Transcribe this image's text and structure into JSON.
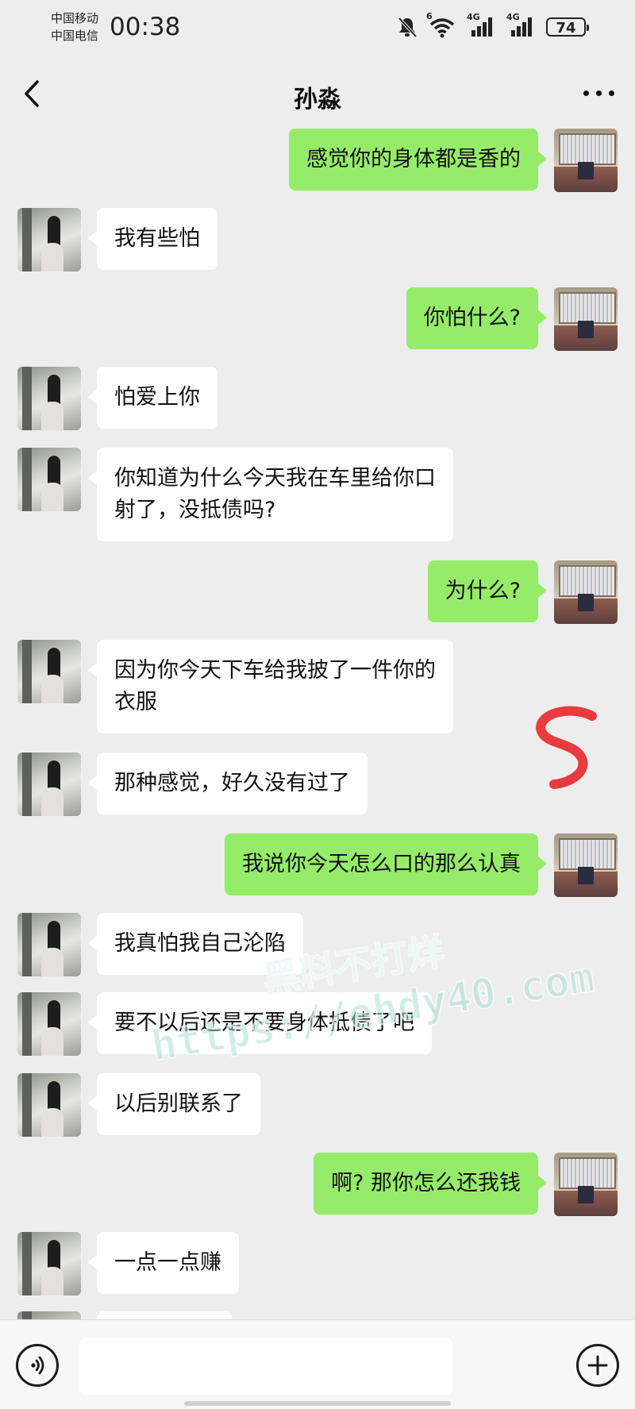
{
  "status_bar": {
    "carrier_1": "中国移动",
    "carrier_2": "中国电信",
    "time": "00:38",
    "wifi_label": "6",
    "signal_1_label": "4G",
    "signal_2_label": "4G",
    "battery": "74"
  },
  "header": {
    "title": "孙淼"
  },
  "messages": [
    {
      "side": "right",
      "text": "感觉你的身体都是香的"
    },
    {
      "side": "left",
      "text": "我有些怕"
    },
    {
      "side": "right",
      "text": "你怕什么?"
    },
    {
      "side": "left",
      "text": "怕爱上你"
    },
    {
      "side": "left",
      "text": "你知道为什么今天我在车里给你口\n射了，没抵债吗?"
    },
    {
      "side": "right",
      "text": "为什么?"
    },
    {
      "side": "left",
      "text": "因为你今天下车给我披了一件你的\n衣服"
    },
    {
      "side": "left",
      "text": "那种感觉，好久没有过了"
    },
    {
      "side": "right",
      "text": "我说你今天怎么口的那么认真"
    },
    {
      "side": "left",
      "text": "我真怕我自己沦陷"
    },
    {
      "side": "left",
      "text": "要不以后还是不要身体抵债了吧"
    },
    {
      "side": "left",
      "text": "以后别联系了"
    },
    {
      "side": "right",
      "text": "啊? 那你怎么还我钱"
    },
    {
      "side": "left",
      "text": "一点一点赚"
    }
  ],
  "watermark": {
    "title": "黑料不打烊",
    "url": "https://ehdy40.com"
  },
  "input_bar": {
    "placeholder": "",
    "value": ""
  },
  "colors": {
    "background": "#ededed",
    "outgoing_bubble": "#95ec69",
    "incoming_bubble": "#ffffff"
  },
  "icons": {
    "back": "chevron-left-icon",
    "more": "ellipsis-icon",
    "voice": "voice-icon",
    "add": "plus-circle-icon"
  }
}
